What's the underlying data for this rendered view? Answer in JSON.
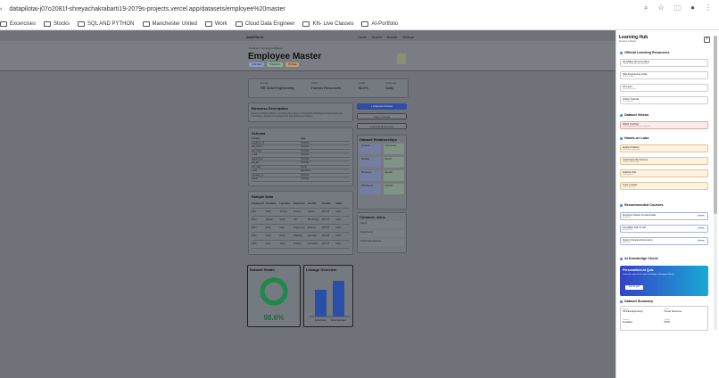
{
  "browser": {
    "url": "datapilotai-j07o2081f-shreyachakrabarti19-2079s-projects.vercel.app/datasets/employee%20master"
  },
  "bookmarks": [
    "Excercises",
    "Stocks",
    "SQL AND PYTHON",
    "Manchester United",
    "Work",
    "Cloud Data Engineer",
    "KN- Live Classes",
    "AI-Portfolio"
  ],
  "app": {
    "brand": "DataPilot AI",
    "nav": [
      "Home",
      "Search",
      "Browse",
      "Settings"
    ],
    "breadcrumb": "Datasets / Employee Master",
    "title": "Employee Master",
    "tags": [
      "Gold Data",
      "Production",
      "PII Data"
    ]
  },
  "stats": [
    {
      "label": "Domain",
      "value": "HR Data Engineering"
    },
    {
      "label": "Owner",
      "value": "Human Resources"
    },
    {
      "label": "Quality",
      "value": "98.6%"
    },
    {
      "label": "Frequency",
      "value": "Daily"
    }
  ],
  "description": {
    "title": "Business Description",
    "text": "Employee Master dataset containing all employee information including personal details, job information, department assignments and employment history."
  },
  "buttons": {
    "request": "+ Request Access",
    "copy": "Copy Lineage",
    "learn": "Learning Resources"
  },
  "schema": {
    "title": "Schema",
    "headers": [
      "Column",
      "Type"
    ],
    "rows": [
      [
        "employee_id",
        "STRING"
      ],
      [
        "first_name",
        "STRING"
      ],
      [
        "last_name",
        "STRING"
      ],
      [
        "email",
        "STRING"
      ],
      [
        "department",
        "STRING"
      ],
      [
        "job_title",
        "STRING"
      ],
      [
        "hire_date",
        "DATE"
      ],
      [
        "salary",
        "DECIMAL"
      ],
      [
        "manager_id",
        "STRING"
      ],
      [
        "status",
        "STRING"
      ]
    ]
  },
  "relationships": {
    "title": "Dataset Relationships",
    "upstream": [
      "Upstream",
      "Workday",
      "HR Source",
      "HRIS Extract"
    ],
    "downstream": [
      "Downstream",
      "Payroll",
      "Benefits",
      "Analytics"
    ]
  },
  "sample": {
    "title": "Sample Data",
    "headers": [
      "Employee ID",
      "First Name",
      "Last Name",
      "Department",
      "Job Title",
      "Hire Date",
      "Status"
    ],
    "rows": [
      [
        "E001",
        "Sarah",
        "Johnson",
        "Finance",
        "Analyst",
        "2021-03",
        "Active"
      ],
      [
        "E002",
        "Michael",
        "Smith",
        "HR",
        "HR Manager",
        "2019-07",
        "Active"
      ],
      [
        "E003",
        "Emily",
        "Davis",
        "Engineering",
        "Engineer",
        "2020-01",
        "Active"
      ],
      [
        "E004",
        "David",
        "Brown",
        "Marketing",
        "Specialist",
        "2022-05",
        "Active"
      ],
      [
        "E005",
        "Anna",
        "Taylor",
        "Finance",
        "Accountant",
        "2018-11",
        "Active"
      ]
    ]
  },
  "joins": {
    "title": "Common Joins",
    "items": [
      "Payroll",
      "Departments",
      "Performance Reviews"
    ]
  },
  "health": {
    "title": "Dataset Health",
    "score": "98.6%",
    "fraction": 0.986
  },
  "lineage": {
    "title": "Lineage Overview"
  },
  "chart_data": {
    "type": "bar",
    "categories": [
      "Upstream",
      "Downstream"
    ],
    "values": [
      3,
      4
    ]
  },
  "panel": {
    "title": "Learning Hub",
    "subtitle": "Employee Master",
    "close": "×",
    "sec1": "Official Learning Resources",
    "res": [
      {
        "t": "Snowflake Documentation",
        "s": "Official Snowflake documentation"
      },
      {
        "t": "Data Engineering Guide",
        "s": "Best practices"
      },
      {
        "t": "dbt Learn",
        "s": "Free dbt courses"
      },
      {
        "t": "Airflow Tutorials",
        "s": "Orchestration"
      }
    ],
    "sec2": "Dataset Videos",
    "vid": {
      "t": "Watch YouTube",
      "s": "Learn Employee Master in minutes"
    },
    "sec3": "Hands-on Labs",
    "labs": [
      {
        "t": "Explore Dataset",
        "s": "Interactive exploration"
      },
      {
        "t": "Understand the Schema",
        "s": "Column walkthrough"
      },
      {
        "t": "Practice SQL",
        "s": "Write queries"
      },
      {
        "t": "Trace Lineage",
        "s": "Follow the flow"
      }
    ],
    "sec4": "Recommended Courses",
    "courses": [
      {
        "t": "Employee Master Fundamentals",
        "s": "Beginner",
        "b": "Course"
      },
      {
        "t": "Snowflake SQL for HR",
        "s": "Intermediate",
        "b": "Course"
      },
      {
        "t": "Slowly Changing Dimensions",
        "s": "Advanced",
        "b": "Course"
      }
    ],
    "sec5": "AI Knowledge Check",
    "quiz": {
      "t": "Personalized AI Quiz",
      "s": "Generate a quiz to test your knowledge of Employee Master",
      "b": "Start AI Quiz"
    },
    "sec6": "Dataset Summary",
    "summary": [
      {
        "k": "Domain",
        "v": "HR Data Engineering"
      },
      {
        "k": "Owner",
        "v": "Human Resources"
      },
      {
        "k": "Platform",
        "v": "Snowflake"
      },
      {
        "k": "Quality",
        "v": "98.6%"
      }
    ]
  }
}
